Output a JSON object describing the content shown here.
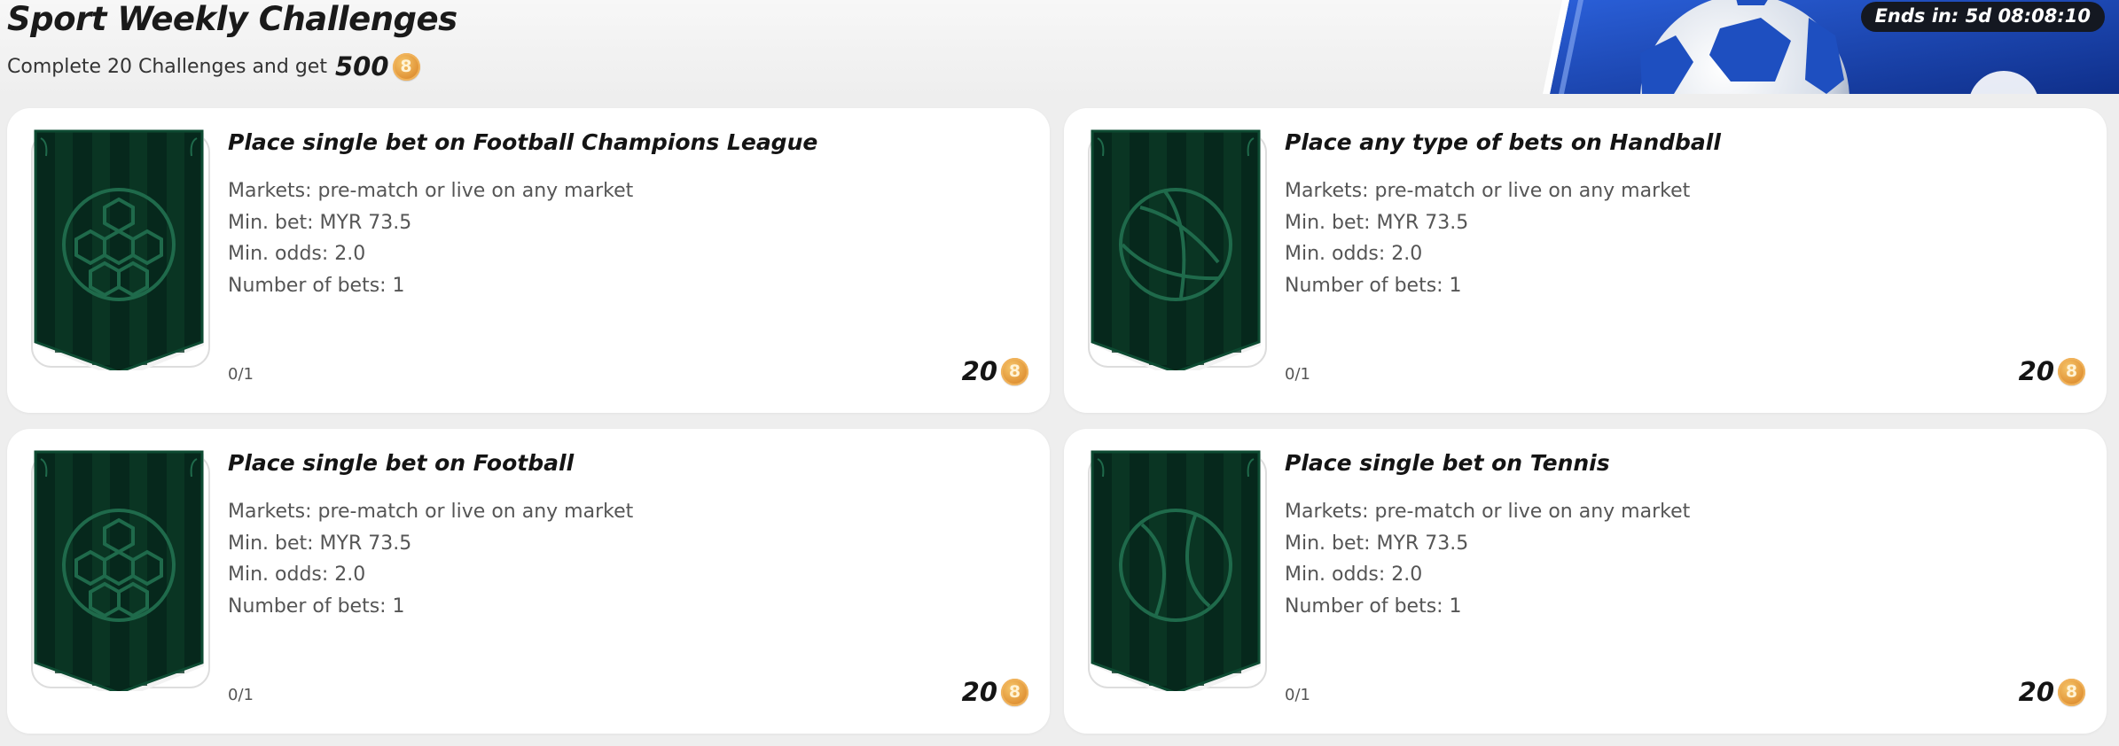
{
  "header": {
    "title": "Sport Weekly Challenges",
    "subtitle_prefix": "Complete 20 Challenges and get",
    "subtitle_amount": "500",
    "coin_symbol": "8",
    "timer": "Ends in: 5d 08:08:10"
  },
  "colors": {
    "badge_dark": "#06281c",
    "badge_green": "#0f4a33",
    "icon_stroke": "#1f6a4b",
    "banner_blue": "#1e4fc0",
    "coin_gold": "#e2973a"
  },
  "challenges": [
    {
      "title": "Place single bet on Football Champions League",
      "markets": "Markets:  pre-match or live on any market",
      "min_bet": "Min. bet: MYR 73.5",
      "min_odds": "Min. odds: 2.0",
      "num_bets": "Number of bets: 1",
      "progress": "0/1",
      "reward": "20",
      "icon": "football-icon"
    },
    {
      "title": "Place any type of bets on Handball",
      "markets": "Markets:  pre-match or live on any market",
      "min_bet": "Min. bet: MYR 73.5",
      "min_odds": "Min. odds: 2.0",
      "num_bets": "Number of bets: 1",
      "progress": "0/1",
      "reward": "20",
      "icon": "handball-icon"
    },
    {
      "title": "Place single bet on Football",
      "markets": "Markets:  pre-match or live on any market",
      "min_bet": "Min. bet: MYR 73.5",
      "min_odds": "Min. odds: 2.0",
      "num_bets": "Number of bets: 1",
      "progress": "0/1",
      "reward": "20",
      "icon": "football-icon"
    },
    {
      "title": "Place single bet on Tennis",
      "markets": "Markets:  pre-match or live on any market",
      "min_bet": "Min. bet: MYR 73.5",
      "min_odds": "Min. odds: 2.0",
      "num_bets": "Number of bets: 1",
      "progress": "0/1",
      "reward": "20",
      "icon": "tennis-icon"
    }
  ]
}
